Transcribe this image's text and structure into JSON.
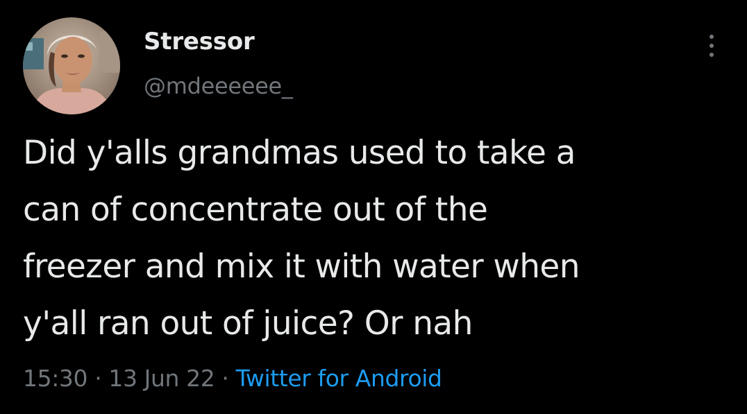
{
  "tweet": {
    "author": {
      "display_name": "Stressor",
      "handle": "@mdeeeeee_",
      "avatar_icon": "profile-photo"
    },
    "more_icon": "more-vertical-icon",
    "text_lines": [
      "Did y'alls grandmas used to take a",
      "can of concentrate out of the",
      "freezer and mix it with water when",
      "y'all ran out of juice? Or nah"
    ],
    "time": "15:30",
    "separator": " · ",
    "date": "13 Jun 22",
    "source": "Twitter for Android"
  },
  "colors": {
    "background": "#000000",
    "text_primary": "#e7e9ea",
    "text_secondary": "#71767b",
    "link": "#1d9bf0"
  }
}
